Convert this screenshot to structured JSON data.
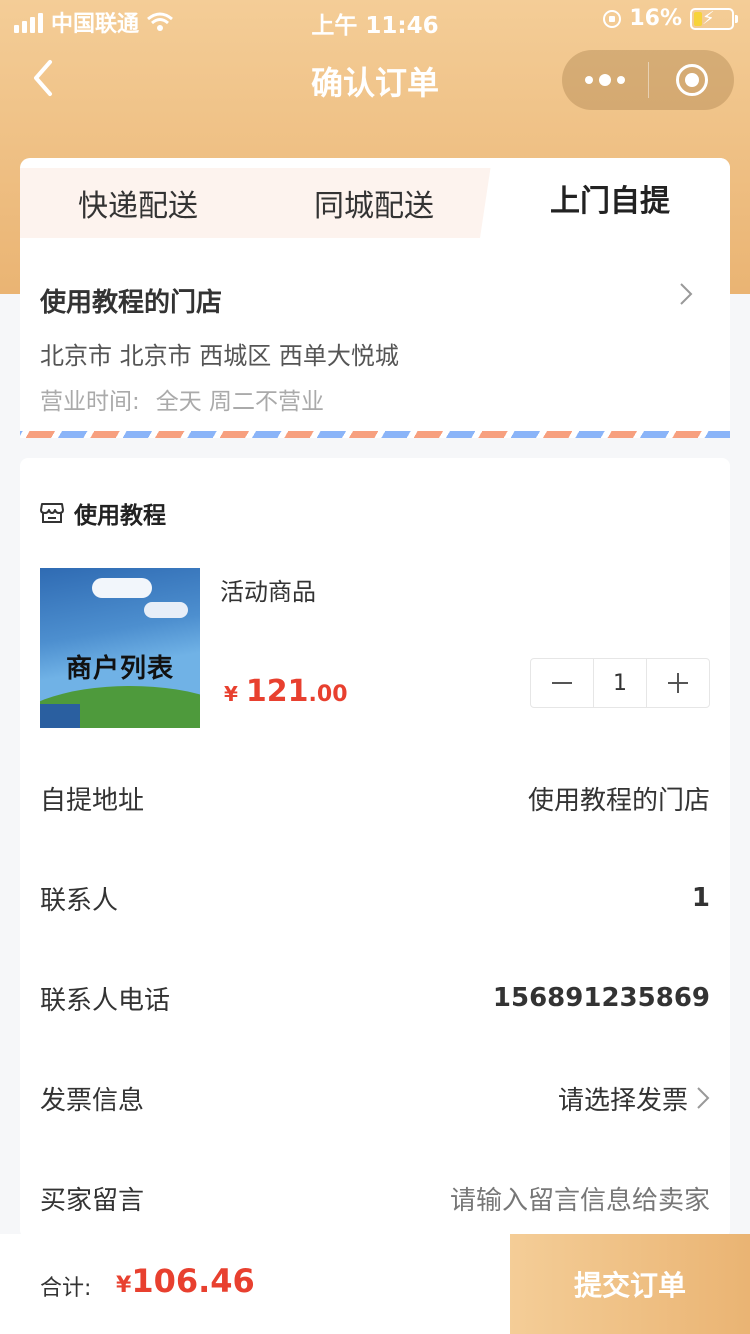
{
  "status_bar": {
    "carrier": "中国联通",
    "time": "上午 11:46",
    "battery_percent": "16%"
  },
  "nav": {
    "title": "确认订单"
  },
  "delivery_tabs": [
    {
      "label": "快递配送",
      "active": false
    },
    {
      "label": "同城配送",
      "active": false
    },
    {
      "label": "上门自提",
      "active": true
    }
  ],
  "store": {
    "name": "使用教程的门店",
    "address": "北京市 北京市 西城区 西单大悦城",
    "hours_label": "营业时间:",
    "hours_value": "全天 周二不营业"
  },
  "order": {
    "shop_name": "使用教程",
    "product": {
      "image_text": "商户列表",
      "name": "活动商品",
      "price_currency": "¥",
      "price_int": "121",
      "price_dec": ".00",
      "quantity": "1"
    },
    "rows": [
      {
        "label": "自提地址",
        "value": "使用教程的门店"
      },
      {
        "label": "联系人",
        "value": "1"
      },
      {
        "label": "联系人电话",
        "value": "156891235869"
      },
      {
        "label": "发票信息",
        "value": "请选择发票"
      },
      {
        "label": "买家留言",
        "placeholder": "请输入留言信息给卖家"
      }
    ]
  },
  "footer": {
    "total_label": "合计:",
    "currency": "¥",
    "total": "106.46",
    "submit_label": "提交订单"
  },
  "colors": {
    "accent_gradient_start": "#f4cd97",
    "accent_gradient_end": "#eab473",
    "price_red": "#e8402f"
  }
}
